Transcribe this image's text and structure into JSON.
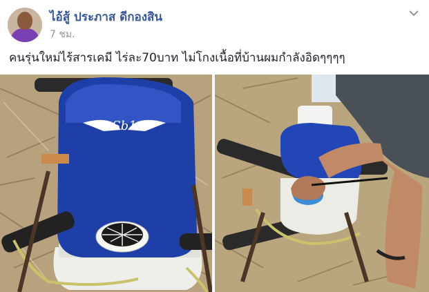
{
  "post": {
    "author_name": "ไอ้สู้ ประภาส ดีกองสิน",
    "timestamp": "7 ชม.",
    "text": "คนรุ่นใหม่ไร้สารเคมี ไร่ละ70บาท ไม่โกงเนื้อที่บ้านผมกำลังอิดๆๆๆๆ",
    "logo_text": "Sb1",
    "icons": {
      "options": "chevron-down-icon",
      "avatar": "avatar"
    },
    "colors": {
      "author_link": "#365899",
      "timestamp": "#90949c",
      "tank": "#1f3fa8"
    }
  }
}
